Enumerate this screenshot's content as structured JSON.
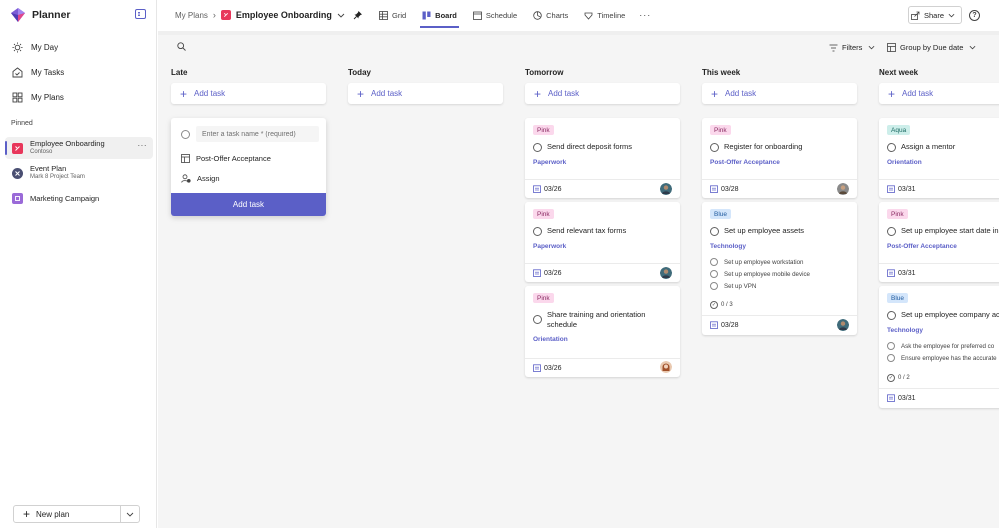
{
  "app": {
    "name": "Planner"
  },
  "nav": [
    {
      "label": "My Day",
      "icon": "sun-icon"
    },
    {
      "label": "My Tasks",
      "icon": "tasks-icon"
    },
    {
      "label": "My Plans",
      "icon": "grid-icon"
    }
  ],
  "pinned_label": "Pinned",
  "pinned": [
    {
      "name": "Employee Onboarding",
      "sub": "Contoso",
      "color": "#e8375b"
    },
    {
      "name": "Event Plan",
      "sub": "Mark 8 Project Team",
      "color": "#4a4f72"
    },
    {
      "name": "Marketing Campaign",
      "sub": "",
      "color": "#9a6ad8"
    }
  ],
  "new_plan_label": "New plan",
  "breadcrumb": {
    "root": "My Plans",
    "plan": "Employee Onboarding"
  },
  "tabs": [
    "Grid",
    "Board",
    "Schedule",
    "Charts",
    "Timeline"
  ],
  "active_tab": "Board",
  "share_label": "Share",
  "toolbar": {
    "filters": "Filters",
    "group_by": "Group by Due date"
  },
  "columns": [
    "Late",
    "Today",
    "Tomorrow",
    "This week",
    "Next week"
  ],
  "add_task_label": "Add task",
  "new_task": {
    "placeholder": "Enter a task name * (required)",
    "bucket": "Post-Offer Acceptance",
    "assign": "Assign",
    "button": "Add task"
  },
  "cards": {
    "tomorrow": [
      {
        "label": "Pink",
        "title": "Send direct deposit forms",
        "bucket": "Paperwork",
        "due": "03/26"
      },
      {
        "label": "Pink",
        "title": "Send relevant tax forms",
        "bucket": "Paperwork",
        "due": "03/26"
      },
      {
        "label": "Pink",
        "title_line1": "Share training and orientation",
        "title_line2": "schedule",
        "bucket": "Orientation",
        "due": "03/26"
      }
    ],
    "this_week": [
      {
        "label": "Pink",
        "title": "Register for onboarding",
        "bucket": "Post-Offer Acceptance",
        "due": "03/28"
      },
      {
        "label": "Blue",
        "title": "Set up employee assets",
        "bucket": "Technology",
        "checklist": [
          "Set up employee workstation",
          "Set up employee mobile device",
          "Set up VPN"
        ],
        "progress": "0 / 3",
        "due": "03/28"
      }
    ],
    "next_week": [
      {
        "label": "Aqua",
        "title": "Assign a mentor",
        "bucket": "Orientation",
        "due": "03/31"
      },
      {
        "label": "Pink",
        "title": "Set up employee start date in sys",
        "bucket": "Post-Offer Acceptance",
        "due": "03/31"
      },
      {
        "label": "Blue",
        "title": "Set up employee company ac",
        "bucket": "Technology",
        "checklist": [
          "Ask the employee for preferred co",
          "Ensure employee has the accurate"
        ],
        "progress": "0 / 2",
        "due": "03/31"
      }
    ]
  },
  "colors": {
    "accent": "#5b5fc7",
    "pink_label": "#fbd8ec",
    "blue_label": "#d4e6fb",
    "aqua_label": "#cdeeea"
  }
}
